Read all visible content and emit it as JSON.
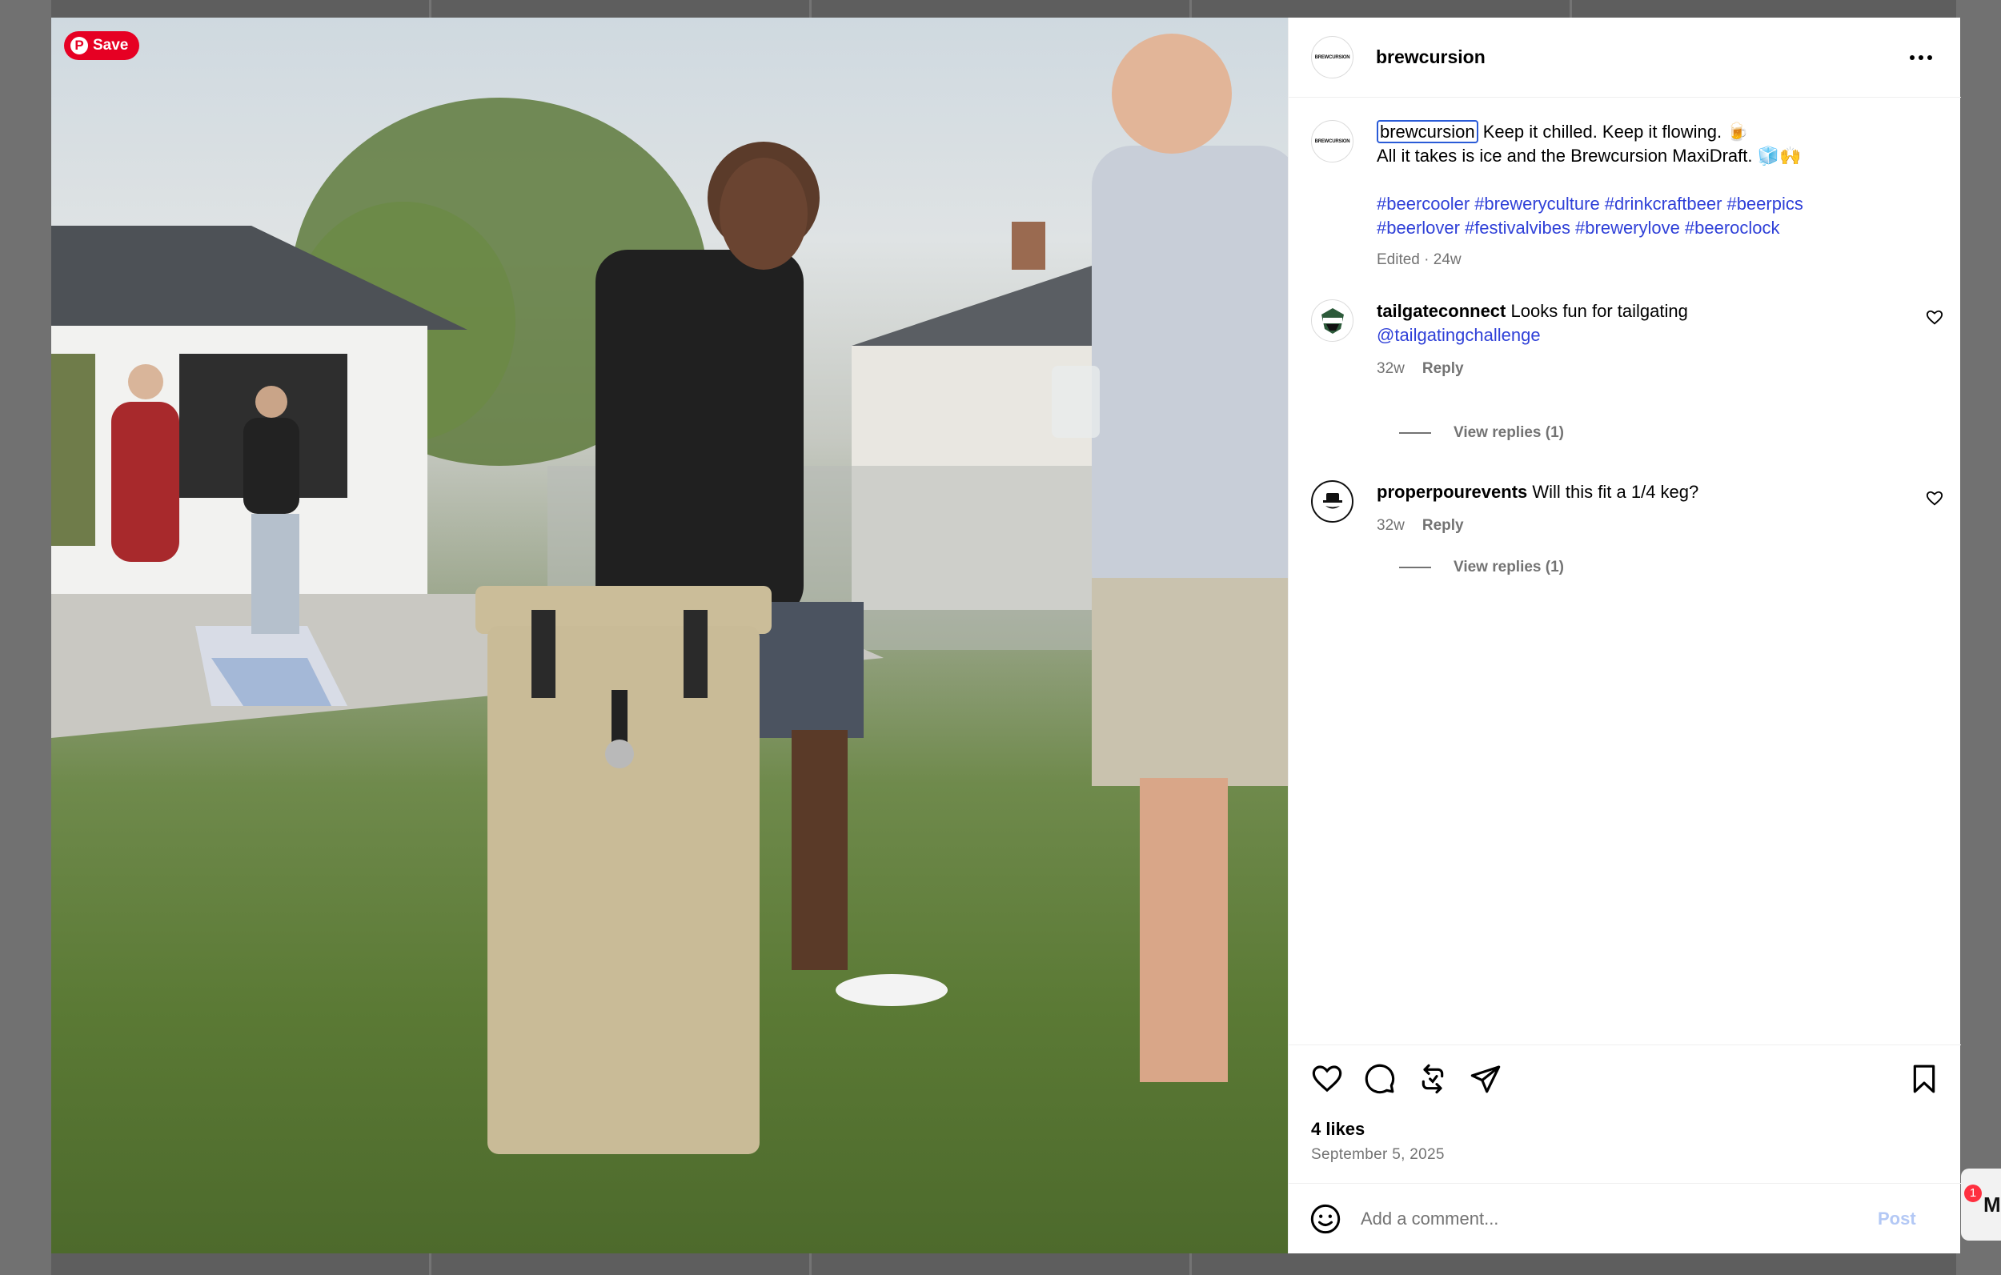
{
  "pin_button": {
    "label": "Save",
    "logo": "P"
  },
  "post": {
    "author": "brewcursion",
    "avatar_text": "BREWCURSION",
    "caption_line1": "Keep it chilled. Keep it flowing. 🍺",
    "caption_line2": "All it takes is ice and the Brewcursion MaxiDraft. 🧊🙌",
    "hashtags": [
      "#beercooler",
      "#breweryculture",
      "#drinkcraftbeer",
      "#beerpics",
      "#beerlover",
      "#festivalvibes",
      "#brewerylove",
      "#beeroclock"
    ],
    "caption_meta": "Edited · 24w"
  },
  "comments": [
    {
      "user": "tailgateconnect",
      "text": "Looks fun for tailgating",
      "mention": "@tailgatingchallenge",
      "age": "32w",
      "reply_label": "Reply",
      "view_replies": "View replies (1)"
    },
    {
      "user": "properpourevents",
      "text": "Will this fit a 1/4 keg?",
      "age": "32w",
      "reply_label": "Reply",
      "view_replies": "View replies (1)"
    }
  ],
  "actions": {
    "likes": "4 likes",
    "date": "September 5, 2025",
    "icons": [
      "heart-icon",
      "comment-icon",
      "repost-icon",
      "share-icon",
      "bookmark-icon"
    ]
  },
  "add_comment": {
    "placeholder": "Add a comment...",
    "post_label": "Post"
  },
  "background": {
    "notification_count": "1",
    "messages_letter": "M"
  },
  "colors": {
    "link_blue": "#3041d8",
    "pinterest_red": "#e60023",
    "secondary_text": "#737373",
    "post_disabled": "#b3c8f5"
  }
}
